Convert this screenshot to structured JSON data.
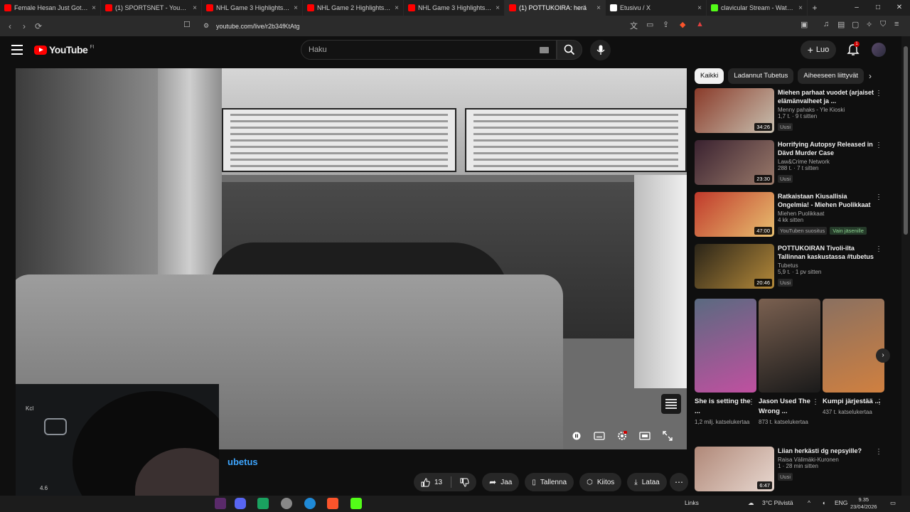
{
  "browser": {
    "tabs": [
      {
        "title": "Female Hesan Just Got Comp",
        "fav": "#ff0000",
        "active": false
      },
      {
        "title": "(1) SPORTSNET - YouTube",
        "fav": "#ff0000",
        "active": false
      },
      {
        "title": "NHL Game 3 Highlights | Peng",
        "fav": "#ff0000",
        "active": false
      },
      {
        "title": "NHL Game 2 Highlights | Duck",
        "fav": "#ff0000",
        "active": false
      },
      {
        "title": "NHL Game 3 Highlights | Stars",
        "fav": "#ff0000",
        "active": false
      },
      {
        "title": "(1) POTTUKOIRA: herä",
        "fav": "#ff0000",
        "active": true
      },
      {
        "title": "Etusivu / X",
        "fav": "#ffffff",
        "active": false
      },
      {
        "title": "clavicular Stream - Watch Live",
        "fav": "#53fc18",
        "active": false
      }
    ],
    "new_tab": "+",
    "url": "youtube.com/live/r2b34fKtAtg",
    "window_controls": [
      "–",
      "□",
      "✕"
    ]
  },
  "masthead": {
    "logo": "YouTube",
    "country": "FI",
    "search_placeholder": "Haku",
    "create_label": "Luo",
    "notif_count": "1"
  },
  "player": {
    "webcam_label": "Kcl",
    "webcam_label2": "4.6"
  },
  "video": {
    "title_visible": "ubetus",
    "like_count": "13",
    "share": "Jaa",
    "save": "Tallenna",
    "thanks": "Kiitos",
    "download": "Lataa"
  },
  "chips": [
    "Kaikki",
    "Ladannut Tubetus",
    "Aiheeseen liittyvät"
  ],
  "recs": [
    {
      "title": "Miehen parhaat vuodet (arjaiset elämänvalheet ja ...",
      "channel": "Menny pahaks - Yle Kioski",
      "stats": "1,7 t. · 9 t sitten",
      "badge": "Uusi",
      "duration": "34:26",
      "thumb": [
        "#8a3b2a",
        "#c8c0b0"
      ]
    },
    {
      "title": "Horrifying Autopsy Released in Dävd Murder Case",
      "channel": "Law&Crime Network",
      "stats": "288 t. · 7 t sitten",
      "badge": "Uusi",
      "duration": "23:30",
      "thumb": [
        "#3a2230",
        "#9a7a6a"
      ]
    },
    {
      "title": "Ratkaistaan Kiusallisia Ongelmia! - Miehen Puolikkaat",
      "channel": "Miehen Puolikkaat",
      "stats": "4 kk sitten",
      "badge": "YouTuben suositus",
      "member": "Vain jäsenille",
      "duration": "47:00",
      "thumb": [
        "#c0392b",
        "#e8c070"
      ]
    },
    {
      "title": "POTTUKOIRAN Tivoli-ilta Tallinnan kaskustassa #tubetus",
      "channel": "Tubetus",
      "stats": "5,9 t. · 1 pv sitten",
      "badge": "Uusi",
      "duration": "20:46",
      "thumb": [
        "#2a2418",
        "#b58a3a"
      ]
    },
    {
      "title": "Liian herkästi dg nepsyille?",
      "channel": "Raisa Välimäki-Kuronen",
      "stats": "1 · 28 min sitten",
      "badge": "Uusi",
      "duration": "6:47",
      "thumb": [
        "#b08878",
        "#e8d8d0"
      ]
    }
  ],
  "shorts": [
    {
      "title": "She is setting the ...",
      "views": "1,2 milj. katselukertaa",
      "colors": [
        "#5a6a80",
        "#c050a0"
      ]
    },
    {
      "title": "Jason Used The Wrong ...",
      "views": "873 t. katselukertaa",
      "colors": [
        "#7a6050",
        "#1a1a1a"
      ]
    },
    {
      "title": "Kumpi järjestää ...",
      "views": "437 t. katselukertaa",
      "colors": [
        "#8a7060",
        "#d08040"
      ]
    }
  ],
  "taskbar": {
    "links": "Links",
    "weather": "3°C Pilvistä",
    "lang": "ENG",
    "time": "9.35",
    "date": "23/04/2026"
  },
  "accent": {
    "youtube_red": "#ff0000",
    "link_blue": "#3ea6ff"
  }
}
